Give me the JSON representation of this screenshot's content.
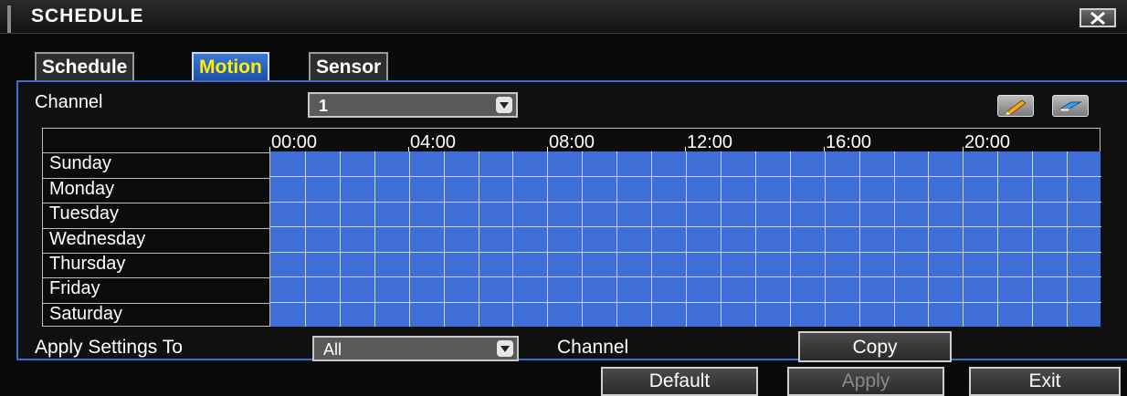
{
  "window": {
    "title": "SCHEDULE"
  },
  "tabs": [
    {
      "label": "Schedule",
      "active": false
    },
    {
      "label": "Motion",
      "active": true
    },
    {
      "label": "Sensor",
      "active": false
    }
  ],
  "channel": {
    "label": "Channel",
    "value": "1"
  },
  "tools": {
    "edit_icon": "pencil-icon",
    "erase_icon": "eraser-icon"
  },
  "schedule": {
    "hour_labels": [
      "00:00",
      "04:00",
      "08:00",
      "12:00",
      "16:00",
      "20:00"
    ],
    "days": [
      "Sunday",
      "Monday",
      "Tuesday",
      "Wednesday",
      "Thursday",
      "Friday",
      "Saturday"
    ],
    "all_hours_enabled": true,
    "enabled_color": "#3f6fd6"
  },
  "apply": {
    "label": "Apply Settings To",
    "value": "All",
    "channel_label": "Channel",
    "copy_label": "Copy"
  },
  "footer": {
    "default_label": "Default",
    "apply_label": "Apply",
    "exit_label": "Exit"
  }
}
